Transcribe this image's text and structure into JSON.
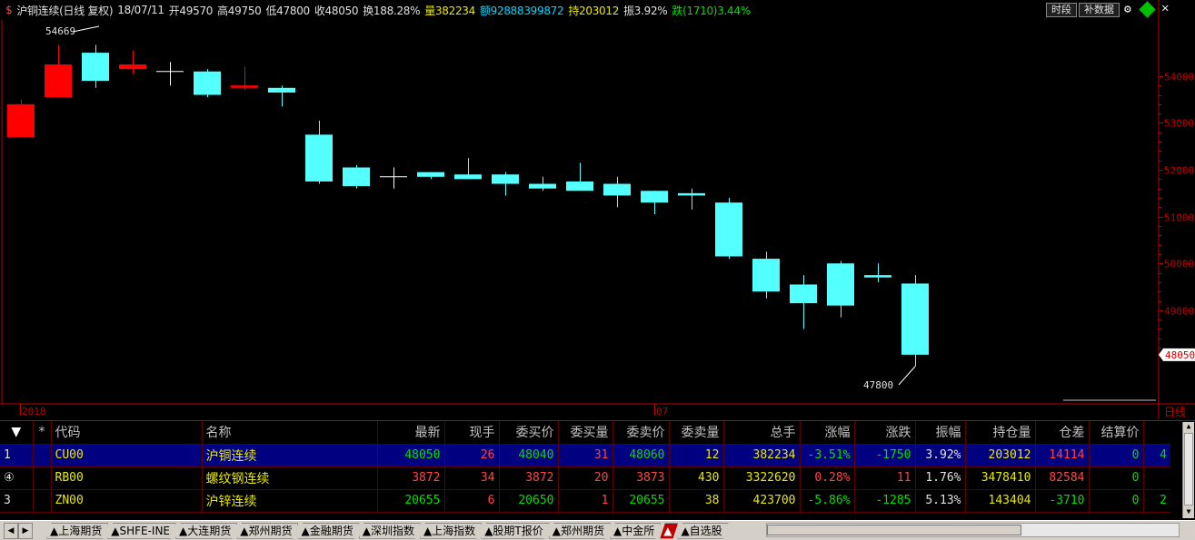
{
  "title": {
    "symbol_icon": "$",
    "name": "沪铜连续(日线 复权)",
    "date": "18/07/11",
    "open": "开49570",
    "high": "高49750",
    "low": "低47800",
    "close": "收48050",
    "turnover": "换188.28%",
    "volume": "量382234",
    "amount": "额92888399872",
    "open_interest": "持203012",
    "amplitude": "振3.92%",
    "change": "跌(1710)3.44%"
  },
  "toolbar": {
    "period_btn": "时段",
    "fill_btn": "补数据"
  },
  "axis": {
    "right_labels": [
      "54000",
      "53000",
      "52000",
      "51000",
      "50000",
      "49000"
    ],
    "current_price": "48050",
    "period_label": "日线",
    "date_labels": [
      "2018",
      "07"
    ],
    "max_marker": "54669",
    "min_marker": "47800"
  },
  "chart_data": {
    "type": "candlestick",
    "ylim": [
      47000,
      55200
    ],
    "candles": [
      {
        "o": 52700,
        "h": 53500,
        "l": 52700,
        "c": 53400
      },
      {
        "o": 53550,
        "h": 54669,
        "l": 53550,
        "c": 54250
      },
      {
        "o": 54500,
        "h": 54669,
        "l": 53750,
        "c": 53900
      },
      {
        "o": 54150,
        "h": 54550,
        "l": 54050,
        "c": 54250
      },
      {
        "o": 54100,
        "h": 54300,
        "l": 53800,
        "c": 54100
      },
      {
        "o": 54100,
        "h": 54150,
        "l": 53550,
        "c": 53600
      },
      {
        "o": 53750,
        "h": 54200,
        "l": 53700,
        "c": 53800
      },
      {
        "o": 53750,
        "h": 53800,
        "l": 53350,
        "c": 53650
      },
      {
        "o": 52750,
        "h": 53050,
        "l": 51700,
        "c": 51750
      },
      {
        "o": 52050,
        "h": 52100,
        "l": 51600,
        "c": 51650
      },
      {
        "o": 51850,
        "h": 52050,
        "l": 51600,
        "c": 51850
      },
      {
        "o": 51950,
        "h": 51950,
        "l": 51800,
        "c": 51850
      },
      {
        "o": 51900,
        "h": 52250,
        "l": 51800,
        "c": 51800
      },
      {
        "o": 51900,
        "h": 51950,
        "l": 51450,
        "c": 51700
      },
      {
        "o": 51700,
        "h": 51850,
        "l": 51550,
        "c": 51600
      },
      {
        "o": 51750,
        "h": 52150,
        "l": 51600,
        "c": 51550
      },
      {
        "o": 51700,
        "h": 51850,
        "l": 51200,
        "c": 51450
      },
      {
        "o": 51550,
        "h": 51550,
        "l": 51050,
        "c": 51300
      },
      {
        "o": 51500,
        "h": 51600,
        "l": 51150,
        "c": 51450
      },
      {
        "o": 51300,
        "h": 51400,
        "l": 50100,
        "c": 50150
      },
      {
        "o": 50100,
        "h": 50250,
        "l": 49250,
        "c": 49400
      },
      {
        "o": 49550,
        "h": 49750,
        "l": 48600,
        "c": 49150
      },
      {
        "o": 50000,
        "h": 50050,
        "l": 48850,
        "c": 49100
      },
      {
        "o": 49750,
        "h": 50000,
        "l": 49600,
        "c": 49700
      },
      {
        "o": 49570,
        "h": 49750,
        "l": 47800,
        "c": 48050
      }
    ]
  },
  "table": {
    "headers": [
      "*",
      "代码",
      "名称",
      "最新",
      "现手",
      "委买价",
      "委买量",
      "委卖价",
      "委卖量",
      "总手",
      "涨幅",
      "涨跌",
      "振幅",
      "持仓量",
      "仓差",
      "结算价"
    ],
    "rows": [
      {
        "no": "1",
        "code": "CU00",
        "name": "沪铜连续",
        "last": "48050",
        "now": "26",
        "bid": "48040",
        "bidv": "31",
        "ask": "48060",
        "askv": "12",
        "vol": "382234",
        "pct": "-3.51%",
        "chg": "-1750",
        "amp": "3.92%",
        "oi": "203012",
        "oid": "14114",
        "settle": "0",
        "extra": "4"
      },
      {
        "no": "④",
        "code": "RB00",
        "name": "螺纹钢连续",
        "last": "3872",
        "now": "34",
        "bid": "3872",
        "bidv": "20",
        "ask": "3873",
        "askv": "430",
        "vol": "3322620",
        "pct": "0.28%",
        "chg": "11",
        "amp": "1.76%",
        "oi": "3478410",
        "oid": "82584",
        "settle": "0",
        "extra": ""
      },
      {
        "no": "3",
        "code": "ZN00",
        "name": "沪锌连续",
        "last": "20655",
        "now": "6",
        "bid": "20650",
        "bidv": "1",
        "ask": "20655",
        "askv": "38",
        "vol": "423700",
        "pct": "-5.86%",
        "chg": "-1285",
        "amp": "5.13%",
        "oi": "143404",
        "oid": "-3710",
        "settle": "0",
        "extra": "2"
      }
    ]
  },
  "tabs": [
    "▲上海期货",
    "▲SHFE-INE",
    "▲大连期货",
    "▲郑州期货",
    "▲金融期货",
    "▲深圳指数",
    "▲上海指数",
    "▲股期T报价",
    "▲郑州期货",
    "▲中金所",
    "▲",
    "▲自选股"
  ],
  "colors": {
    "up": "#ff0000",
    "down": "#54ffff",
    "axis": "#c00000",
    "grid": "#5a0000"
  }
}
